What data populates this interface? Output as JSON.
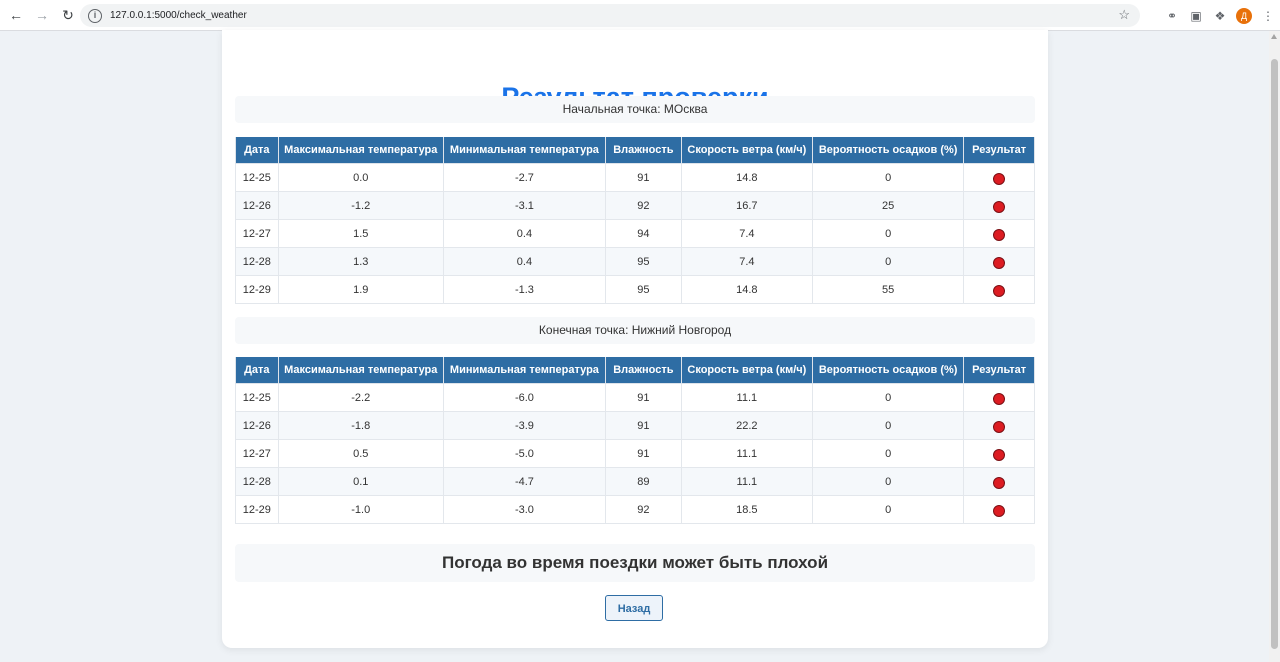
{
  "browser": {
    "url": "127.0.0.1:5000/check_weather",
    "avatar_letter": "Д"
  },
  "page": {
    "title": "Результат проверки",
    "conclusion": "Погода во время поездки может быть плохой",
    "back_label": "Назад"
  },
  "columns": [
    "Дата",
    "Максимальная температура",
    "Минимальная температура",
    "Влажность",
    "Скорость ветра (км/ч)",
    "Вероятность осадков (%)",
    "Результат"
  ],
  "result_color": "#dc1c22",
  "start": {
    "label": "Начальная точка: МОсква",
    "rows": [
      [
        "12-25",
        "0.0",
        "-2.7",
        "91",
        "14.8",
        "0"
      ],
      [
        "12-26",
        "-1.2",
        "-3.1",
        "92",
        "16.7",
        "25"
      ],
      [
        "12-27",
        "1.5",
        "0.4",
        "94",
        "7.4",
        "0"
      ],
      [
        "12-28",
        "1.3",
        "0.4",
        "95",
        "7.4",
        "0"
      ],
      [
        "12-29",
        "1.9",
        "-1.3",
        "95",
        "14.8",
        "55"
      ]
    ]
  },
  "end": {
    "label": "Конечная точка: Нижний Новгород",
    "rows": [
      [
        "12-25",
        "-2.2",
        "-6.0",
        "91",
        "11.1",
        "0"
      ],
      [
        "12-26",
        "-1.8",
        "-3.9",
        "91",
        "22.2",
        "0"
      ],
      [
        "12-27",
        "0.5",
        "-5.0",
        "91",
        "11.1",
        "0"
      ],
      [
        "12-28",
        "0.1",
        "-4.7",
        "89",
        "11.1",
        "0"
      ],
      [
        "12-29",
        "-1.0",
        "-3.0",
        "92",
        "18.5",
        "0"
      ]
    ]
  }
}
